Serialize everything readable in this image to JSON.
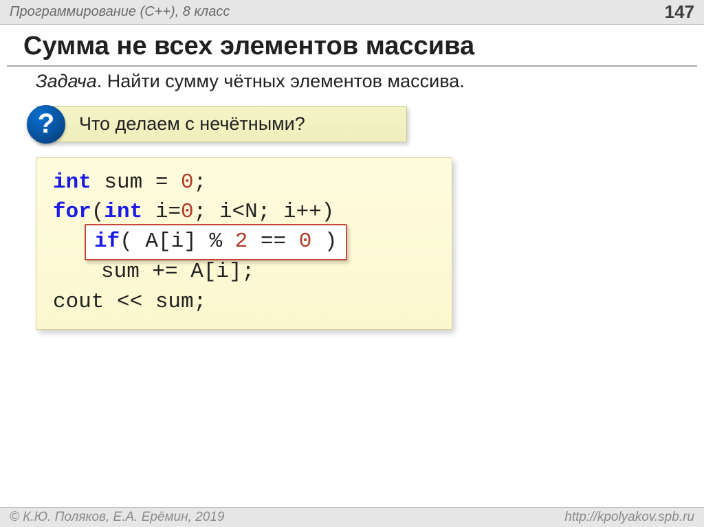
{
  "header": {
    "course": "Программирование (C++), 8 класс",
    "page": "147"
  },
  "title": "Сумма не всех элементов массива",
  "task": {
    "label": "Задача",
    "text": ". Найти сумму чётных элементов массива."
  },
  "callout": {
    "badge": "?",
    "text": "Что делаем с нечётными?"
  },
  "code": {
    "l1_kw": "int",
    "l1_rest": " sum = ",
    "l1_num": "0",
    "l1_end": ";",
    "l2_kw": "for",
    "l2_a": "(",
    "l2_kw2": "int",
    "l2_b": " i=",
    "l2_num": "0",
    "l2_c": "; i<N; i++)",
    "hl_kw": "if",
    "hl_a": "( A[i] % ",
    "hl_num1": "2",
    "hl_b": " == ",
    "hl_num2": "0",
    "hl_c": " )",
    "l4": "sum += A[i];",
    "l5": "cout << sum;"
  },
  "footer": {
    "left": "© К.Ю. Поляков, Е.А. Ерёмин, 2019",
    "right": "http://kpolyakov.spb.ru"
  }
}
